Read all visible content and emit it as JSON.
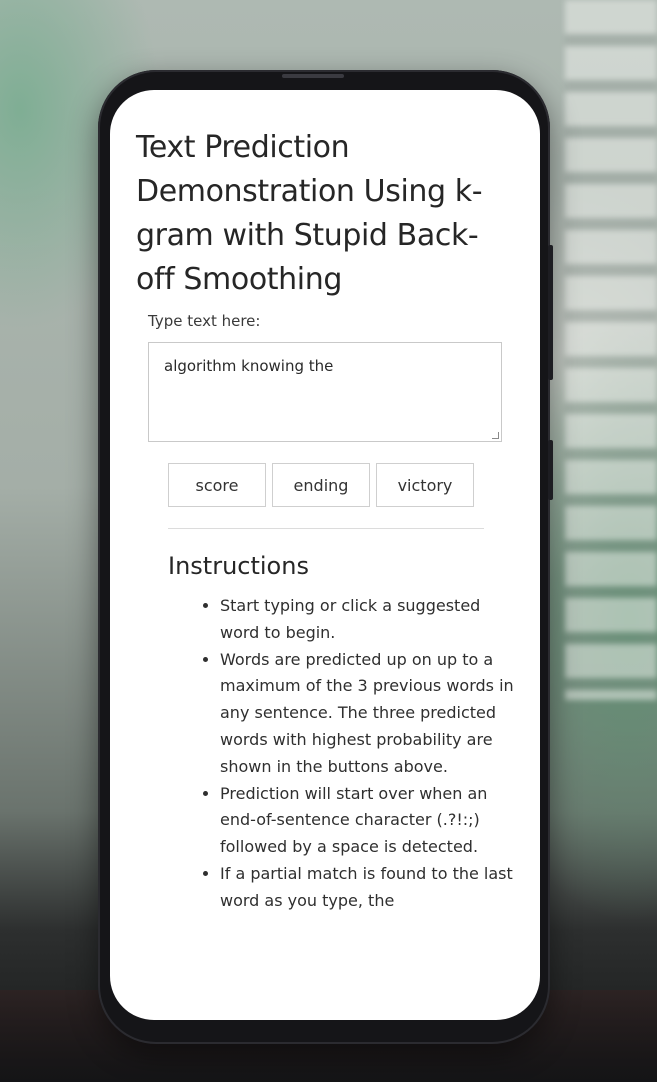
{
  "page": {
    "title": "Text Prediction Demonstration Using k-gram with Stupid Back-off Smoothing"
  },
  "input": {
    "label": "Type text here:",
    "value": "algorithm knowing the"
  },
  "suggestions": [
    {
      "label": "score"
    },
    {
      "label": "ending"
    },
    {
      "label": "victory"
    }
  ],
  "instructions": {
    "heading": "Instructions",
    "items": [
      "Start typing or click a suggested word to begin.",
      "Words are predicted up on up to a maximum of the 3 previous words in any sentence. The three predicted words with highest probability are shown in the buttons above.",
      "Prediction will start over when an end-of-sentence character (.?!:;) followed by a space is detected.",
      "If a partial match is found to the last word as you type, the"
    ]
  }
}
